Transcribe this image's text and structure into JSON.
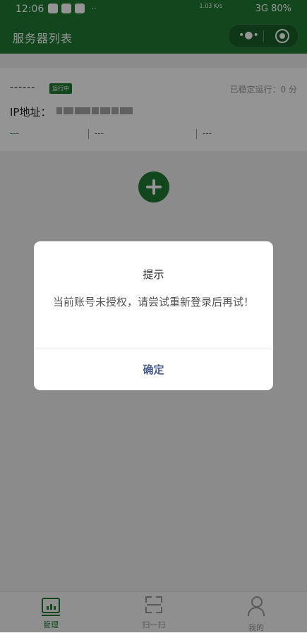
{
  "status_bar": {
    "time": "12:06",
    "net_speed": "1.03 K/s",
    "signal": "3G",
    "battery": "80%"
  },
  "app_bar": {
    "title": "服务器列表",
    "more_label": "•●•"
  },
  "server_card": {
    "name": "------",
    "status_badge": "运行中",
    "uptime": "已稳定运行：0 分",
    "ip_label": "IP地址：",
    "stats": [
      "---",
      "---",
      "---"
    ]
  },
  "tab_bar": {
    "items": [
      {
        "label": "管理",
        "active": true
      },
      {
        "label": "扫一扫",
        "active": false
      },
      {
        "label": "我的",
        "active": false
      }
    ]
  },
  "modal": {
    "title": "提示",
    "content": "当前账号未授权，请尝试重新登录后再试！",
    "confirm_label": "确定"
  },
  "colors": {
    "brand": "#1f7a33",
    "confirm": "#4a5e8a"
  }
}
